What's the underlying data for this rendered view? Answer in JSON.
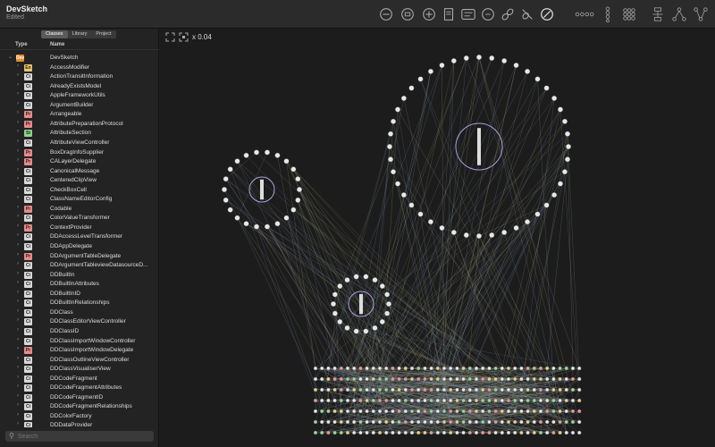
{
  "window": {
    "title": "DevSketch",
    "subtitle": "Edited"
  },
  "toolbar": {
    "icons": [
      "zoom-out-icon",
      "zoom-fit-icon",
      "zoom-in-icon",
      "document-icon",
      "doc-label-icon",
      "type-label-icon",
      "link-icon",
      "no-link-icon",
      "compass-icon",
      "dots-layout-icon",
      "vertical-layout-icon",
      "grid-layout-icon",
      "hierarchy-icon",
      "tree-icon",
      "nodes-icon"
    ]
  },
  "sidebar": {
    "segments": [
      "Classes",
      "Library",
      "Project"
    ],
    "active_segment": "Classes",
    "columns": {
      "type": "Type",
      "name": "Name"
    },
    "items": [
      {
        "type": "Dev",
        "name": "DevSketch",
        "root": true
      },
      {
        "type": "En",
        "name": "AccessModifier"
      },
      {
        "type": "Ci",
        "name": "ActionTransitInformation"
      },
      {
        "type": "Ci",
        "name": "AlreadyExistsModel"
      },
      {
        "type": "Ci",
        "name": "AppleFrameworkUtils"
      },
      {
        "type": "Ci",
        "name": "ArgumentBuilder"
      },
      {
        "type": "Pr",
        "name": "Arrangeable"
      },
      {
        "type": "Pr",
        "name": "AttributePreparationProtocol"
      },
      {
        "type": "St",
        "name": "AttributeSection"
      },
      {
        "type": "Ci",
        "name": "AttributeViewController"
      },
      {
        "type": "Pr",
        "name": "BoxDragInfoSupplier"
      },
      {
        "type": "Pr",
        "name": "CALayerDelegate"
      },
      {
        "type": "Ci",
        "name": "CanonicalMessage"
      },
      {
        "type": "Ci",
        "name": "CenteredClipView"
      },
      {
        "type": "Ci",
        "name": "CheckBoxCell"
      },
      {
        "type": "Ci",
        "name": "ClassNameEditorConfig"
      },
      {
        "type": "Pr",
        "name": "Codable"
      },
      {
        "type": "Ci",
        "name": "ColorValueTransformer"
      },
      {
        "type": "Pr",
        "name": "ContextProvider"
      },
      {
        "type": "Ci",
        "name": "DDAccessLevelTransformer"
      },
      {
        "type": "Ci",
        "name": "DDAppDelegate"
      },
      {
        "type": "Pr",
        "name": "DDArgumentTableDelegate"
      },
      {
        "type": "Ci",
        "name": "DDArgumentTableviewDatasourceD..."
      },
      {
        "type": "Ci",
        "name": "DDBuiltIn"
      },
      {
        "type": "Ci",
        "name": "DDBuiltInAttributes"
      },
      {
        "type": "Ci",
        "name": "DDBuiltInID"
      },
      {
        "type": "Ci",
        "name": "DDBuiltInRelationships"
      },
      {
        "type": "Ci",
        "name": "DDClass"
      },
      {
        "type": "Ci",
        "name": "DDClassEditorViewController"
      },
      {
        "type": "Ci",
        "name": "DDClassID"
      },
      {
        "type": "Ci",
        "name": "DDClassImportWindowController"
      },
      {
        "type": "Pr",
        "name": "DDClassImportWindowDelegate"
      },
      {
        "type": "Ci",
        "name": "DDClassOutlineViewController"
      },
      {
        "type": "Ci",
        "name": "DDClassVisualiserView"
      },
      {
        "type": "Ci",
        "name": "DDCodeFragment"
      },
      {
        "type": "Ci",
        "name": "DDCodeFragmentAttributes"
      },
      {
        "type": "Ci",
        "name": "DDCodeFragmentID"
      },
      {
        "type": "Ci",
        "name": "DDCodeFragmentRelationships"
      },
      {
        "type": "Ci",
        "name": "DDColorFactory"
      },
      {
        "type": "Ci",
        "name": "DDDataProvider"
      }
    ],
    "search": {
      "placeholder": "Search",
      "value": ""
    }
  },
  "canvas": {
    "zoom_label": "x 0.04"
  },
  "colors": {
    "badge_Ci": "#d8d8d8",
    "badge_Pr": "#e98a8a",
    "badge_En": "#e7c56a",
    "badge_St": "#8fd18f",
    "accent": "#e58d2a"
  }
}
